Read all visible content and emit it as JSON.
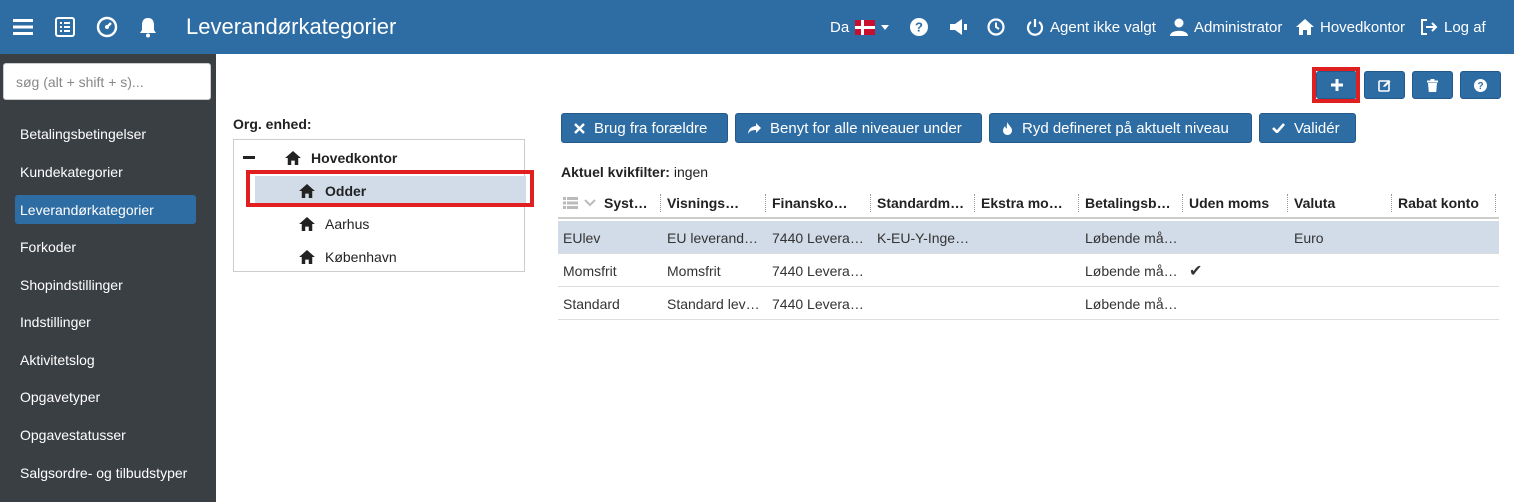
{
  "header": {
    "title": "Leverandørkategorier",
    "language": "Da",
    "agent": "Agent ikke valgt",
    "user": "Administrator",
    "office": "Hovedkontor",
    "logout": "Log af",
    "color": "#2e6da4"
  },
  "sidebar": {
    "search_placeholder": "søg (alt + shift + s)...",
    "items": [
      {
        "label": "Betalingsbetingelser"
      },
      {
        "label": "Kundekategorier"
      },
      {
        "label": "Leverandørkategorier",
        "active": true
      },
      {
        "label": "Forkoder"
      },
      {
        "label": "Shopindstillinger"
      },
      {
        "label": "Indstillinger"
      },
      {
        "label": "Aktivitetslog"
      },
      {
        "label": "Opgavetyper"
      },
      {
        "label": "Opgavestatusser"
      },
      {
        "label": "Salgsordre- og tilbudstyper"
      }
    ]
  },
  "actions": {
    "icons": [
      "plus-icon",
      "edit-icon",
      "trash-icon",
      "help-icon"
    ]
  },
  "org": {
    "label": "Org. enhed:",
    "root": "Hovedkontor",
    "children": [
      "Odder",
      "Aarhus",
      "København"
    ],
    "selected": "Odder"
  },
  "toolbar": {
    "use_parent": "Brug fra forældre",
    "apply_below": "Benyt for alle niveauer under",
    "clear_level": "Ryd defineret på aktuelt niveau",
    "validate": "Validér"
  },
  "filter": {
    "label": "Aktuel kvikfilter:",
    "value": "ingen"
  },
  "grid": {
    "columns": [
      "Syst…",
      "Visnings…",
      "Finansko…",
      "Standardm…",
      "Ekstra mo…",
      "Betalingsb…",
      "Uden moms",
      "Valuta",
      "Rabat konto"
    ],
    "rows": [
      {
        "cells": [
          "EUlev",
          "EU leverand…",
          "7440 Levera…",
          "K-EU-Y-Inge…",
          "",
          "Løbende må…",
          "",
          "Euro",
          ""
        ],
        "selected": true
      },
      {
        "cells": [
          "Momsfrit",
          "Momsfrit",
          "7440 Levera…",
          "",
          "",
          "Løbende må…",
          "✔",
          "",
          ""
        ],
        "selected": false
      },
      {
        "cells": [
          "Standard",
          "Standard lev…",
          "7440 Levera…",
          "",
          "",
          "Løbende må…",
          "",
          "",
          ""
        ],
        "selected": false
      }
    ]
  }
}
